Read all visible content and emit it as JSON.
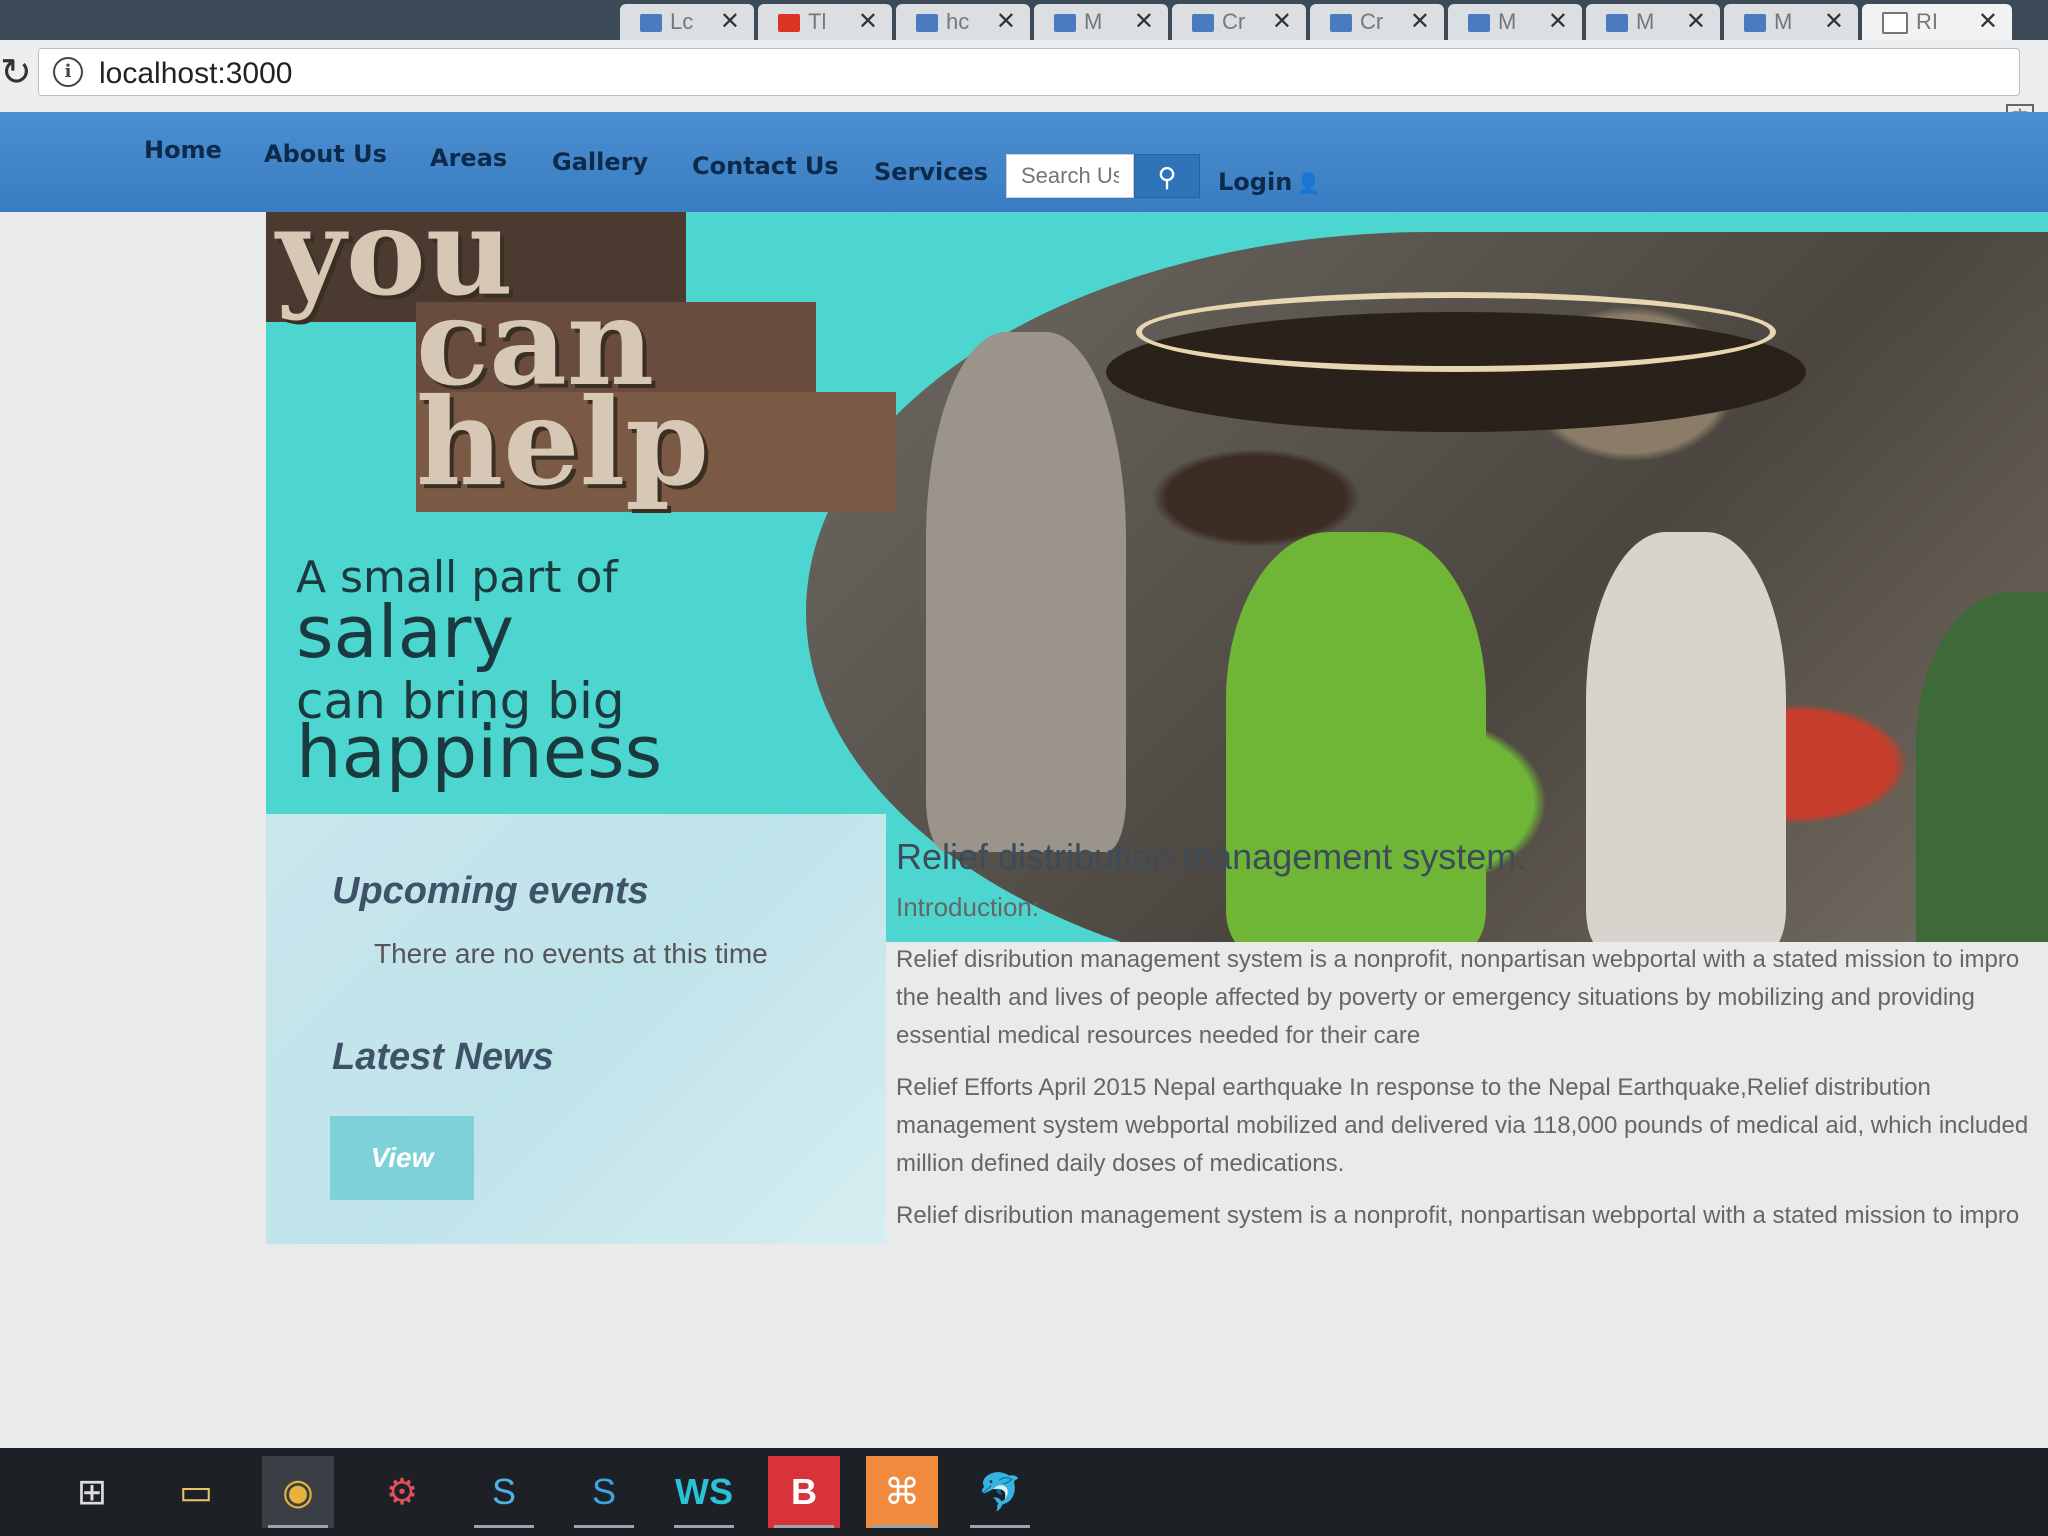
{
  "browser": {
    "tabs": [
      {
        "label": "Lc"
      },
      {
        "label": "Tl"
      },
      {
        "label": "hc"
      },
      {
        "label": "M"
      },
      {
        "label": "Cr"
      },
      {
        "label": "Cr"
      },
      {
        "label": "M"
      },
      {
        "label": "M"
      },
      {
        "label": "M"
      },
      {
        "label": "RI"
      }
    ],
    "url": "localhost:3000"
  },
  "nav": {
    "items": [
      "Home",
      "About Us",
      "Areas",
      "Gallery",
      "Contact Us",
      "Services"
    ],
    "search_placeholder": "Search Us",
    "login_label": "Login"
  },
  "hero": {
    "logo_lines": [
      "you",
      "can",
      "help"
    ],
    "tagline": {
      "line1": "A small part of",
      "line2": "salary",
      "line3": "can bring big",
      "line4": "happiness"
    }
  },
  "sidebar": {
    "events_heading": "Upcoming events",
    "events_text": "There are no events at this time",
    "news_heading": "Latest News",
    "view_button": "View"
  },
  "content": {
    "title": "Relief distribution management system.",
    "intro": "Introduction:",
    "para1_lines": [
      "Relief disribution management system is a nonprofit, nonpartisan webportal with a stated mission to impro",
      "the health and lives of people affected by poverty or emergency situations by mobilizing and providing",
      "essential medical resources needed for their care"
    ],
    "para2_lines": [
      "Relief Efforts April 2015 Nepal earthquake In response to the Nepal Earthquake,Relief distribution",
      "management system webportal mobilized and delivered via 118,000 pounds of medical aid, which included",
      "million defined daily doses of medications."
    ],
    "para3_lines": [
      "Relief disribution management system is a nonprofit, nonpartisan webportal with a stated mission to impro"
    ]
  },
  "colors": {
    "navbar": "#3a7cc2",
    "hero_teal": "#4dd6cf",
    "sidebar_bg": "#c9e6ec",
    "view_button": "#7ed0d9"
  },
  "taskbar": {
    "icons": [
      "windows-start-icon",
      "store-icon",
      "file-explorer-icon",
      "chrome-icon",
      "settings-app-icon",
      "skype-icon",
      "skype-business-icon",
      "webstorm-icon",
      "brackets-icon",
      "sublime-icon",
      "mysql-workbench-icon"
    ]
  }
}
